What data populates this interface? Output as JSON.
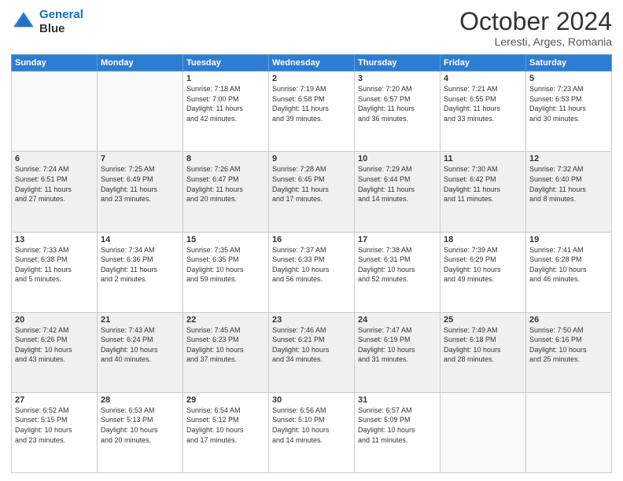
{
  "logo": {
    "line1": "General",
    "line2": "Blue"
  },
  "title": "October 2024",
  "location": "Leresti, Arges, Romania",
  "weekdays": [
    "Sunday",
    "Monday",
    "Tuesday",
    "Wednesday",
    "Thursday",
    "Friday",
    "Saturday"
  ],
  "weeks": [
    [
      {
        "day": "",
        "info": ""
      },
      {
        "day": "",
        "info": ""
      },
      {
        "day": "1",
        "info": "Sunrise: 7:18 AM\nSunset: 7:00 PM\nDaylight: 11 hours\nand 42 minutes."
      },
      {
        "day": "2",
        "info": "Sunrise: 7:19 AM\nSunset: 6:58 PM\nDaylight: 11 hours\nand 39 minutes."
      },
      {
        "day": "3",
        "info": "Sunrise: 7:20 AM\nSunset: 6:57 PM\nDaylight: 11 hours\nand 36 minutes."
      },
      {
        "day": "4",
        "info": "Sunrise: 7:21 AM\nSunset: 6:55 PM\nDaylight: 11 hours\nand 33 minutes."
      },
      {
        "day": "5",
        "info": "Sunrise: 7:23 AM\nSunset: 6:53 PM\nDaylight: 11 hours\nand 30 minutes."
      }
    ],
    [
      {
        "day": "6",
        "info": "Sunrise: 7:24 AM\nSunset: 6:51 PM\nDaylight: 11 hours\nand 27 minutes."
      },
      {
        "day": "7",
        "info": "Sunrise: 7:25 AM\nSunset: 6:49 PM\nDaylight: 11 hours\nand 23 minutes."
      },
      {
        "day": "8",
        "info": "Sunrise: 7:26 AM\nSunset: 6:47 PM\nDaylight: 11 hours\nand 20 minutes."
      },
      {
        "day": "9",
        "info": "Sunrise: 7:28 AM\nSunset: 6:45 PM\nDaylight: 11 hours\nand 17 minutes."
      },
      {
        "day": "10",
        "info": "Sunrise: 7:29 AM\nSunset: 6:44 PM\nDaylight: 11 hours\nand 14 minutes."
      },
      {
        "day": "11",
        "info": "Sunrise: 7:30 AM\nSunset: 6:42 PM\nDaylight: 11 hours\nand 11 minutes."
      },
      {
        "day": "12",
        "info": "Sunrise: 7:32 AM\nSunset: 6:40 PM\nDaylight: 11 hours\nand 8 minutes."
      }
    ],
    [
      {
        "day": "13",
        "info": "Sunrise: 7:33 AM\nSunset: 6:38 PM\nDaylight: 11 hours\nand 5 minutes."
      },
      {
        "day": "14",
        "info": "Sunrise: 7:34 AM\nSunset: 6:36 PM\nDaylight: 11 hours\nand 2 minutes."
      },
      {
        "day": "15",
        "info": "Sunrise: 7:35 AM\nSunset: 6:35 PM\nDaylight: 10 hours\nand 59 minutes."
      },
      {
        "day": "16",
        "info": "Sunrise: 7:37 AM\nSunset: 6:33 PM\nDaylight: 10 hours\nand 56 minutes."
      },
      {
        "day": "17",
        "info": "Sunrise: 7:38 AM\nSunset: 6:31 PM\nDaylight: 10 hours\nand 52 minutes."
      },
      {
        "day": "18",
        "info": "Sunrise: 7:39 AM\nSunset: 6:29 PM\nDaylight: 10 hours\nand 49 minutes."
      },
      {
        "day": "19",
        "info": "Sunrise: 7:41 AM\nSunset: 6:28 PM\nDaylight: 10 hours\nand 46 minutes."
      }
    ],
    [
      {
        "day": "20",
        "info": "Sunrise: 7:42 AM\nSunset: 6:26 PM\nDaylight: 10 hours\nand 43 minutes."
      },
      {
        "day": "21",
        "info": "Sunrise: 7:43 AM\nSunset: 6:24 PM\nDaylight: 10 hours\nand 40 minutes."
      },
      {
        "day": "22",
        "info": "Sunrise: 7:45 AM\nSunset: 6:23 PM\nDaylight: 10 hours\nand 37 minutes."
      },
      {
        "day": "23",
        "info": "Sunrise: 7:46 AM\nSunset: 6:21 PM\nDaylight: 10 hours\nand 34 minutes."
      },
      {
        "day": "24",
        "info": "Sunrise: 7:47 AM\nSunset: 6:19 PM\nDaylight: 10 hours\nand 31 minutes."
      },
      {
        "day": "25",
        "info": "Sunrise: 7:49 AM\nSunset: 6:18 PM\nDaylight: 10 hours\nand 28 minutes."
      },
      {
        "day": "26",
        "info": "Sunrise: 7:50 AM\nSunset: 6:16 PM\nDaylight: 10 hours\nand 25 minutes."
      }
    ],
    [
      {
        "day": "27",
        "info": "Sunrise: 6:52 AM\nSunset: 5:15 PM\nDaylight: 10 hours\nand 23 minutes."
      },
      {
        "day": "28",
        "info": "Sunrise: 6:53 AM\nSunset: 5:13 PM\nDaylight: 10 hours\nand 20 minutes."
      },
      {
        "day": "29",
        "info": "Sunrise: 6:54 AM\nSunset: 5:12 PM\nDaylight: 10 hours\nand 17 minutes."
      },
      {
        "day": "30",
        "info": "Sunrise: 6:56 AM\nSunset: 5:10 PM\nDaylight: 10 hours\nand 14 minutes."
      },
      {
        "day": "31",
        "info": "Sunrise: 6:57 AM\nSunset: 5:09 PM\nDaylight: 10 hours\nand 11 minutes."
      },
      {
        "day": "",
        "info": ""
      },
      {
        "day": "",
        "info": ""
      }
    ]
  ]
}
